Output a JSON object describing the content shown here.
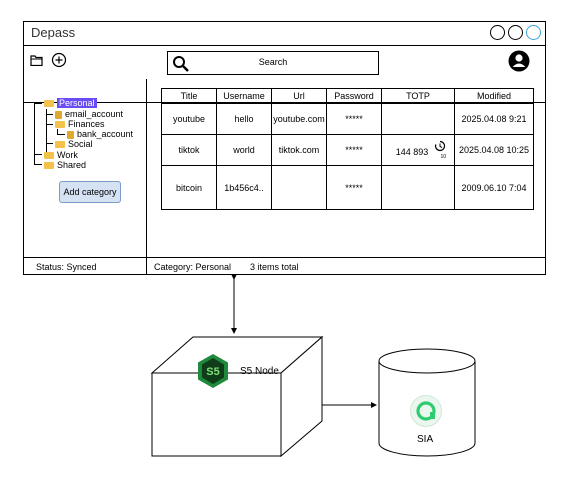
{
  "window": {
    "title": "Depass",
    "search_label": "Search",
    "add_category_label": "Add category",
    "status_left": "Status: Synced",
    "status_category": "Category: Personal",
    "status_count": "3 items total"
  },
  "tree": {
    "personal": "Personal",
    "email_account": "email_account",
    "finances": "Finances",
    "bank_account": "bank_account",
    "social": "Social",
    "work": "Work",
    "shared": "Shared"
  },
  "table": {
    "headers": [
      "Title",
      "Username",
      "Url",
      "Password",
      "TOTP",
      "Modified"
    ],
    "rows": [
      [
        "youtube",
        "hello",
        "youtube.com",
        "*****",
        "",
        "2025.04.08 9:21"
      ],
      [
        "tiktok",
        "world",
        "tiktok.com",
        "*****",
        "144 893",
        "2025.04.08 10:25"
      ],
      [
        "bitcoin",
        "1b456c4..",
        "",
        "*****",
        "",
        "2009.06.10 7:04"
      ]
    ],
    "totp_timer": "10"
  },
  "nodes": {
    "s5_logo": "S5",
    "s5_label": "S5 Node",
    "sia_label": "SIA"
  },
  "colors": {
    "selected": "#6a4cf5",
    "folder": "#f3c24a",
    "button_bg": "#d4e2f4",
    "s5_green": "#1f8a3b",
    "sia_green": "#2ecc71"
  }
}
